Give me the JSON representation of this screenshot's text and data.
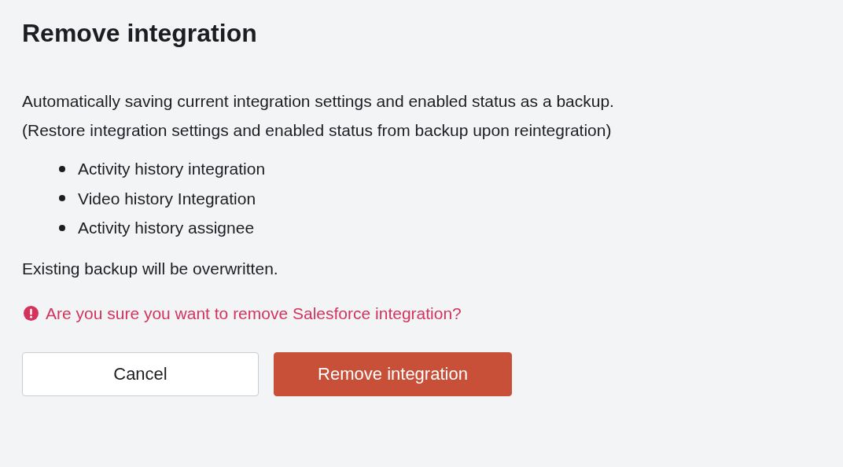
{
  "title": "Remove integration",
  "description": [
    "Automatically saving current integration settings and enabled status as a backup.",
    "(Restore integration settings and enabled status from backup upon reintegration)"
  ],
  "items": [
    "Activity history integration",
    "Video history Integration",
    "Activity history assignee"
  ],
  "note": "Existing backup will be overwritten.",
  "warning": "Are you sure you want to remove Salesforce integration?",
  "buttons": [
    {
      "label": "Cancel",
      "kind": "secondary"
    },
    {
      "label": "Remove integration",
      "kind": "danger"
    }
  ]
}
